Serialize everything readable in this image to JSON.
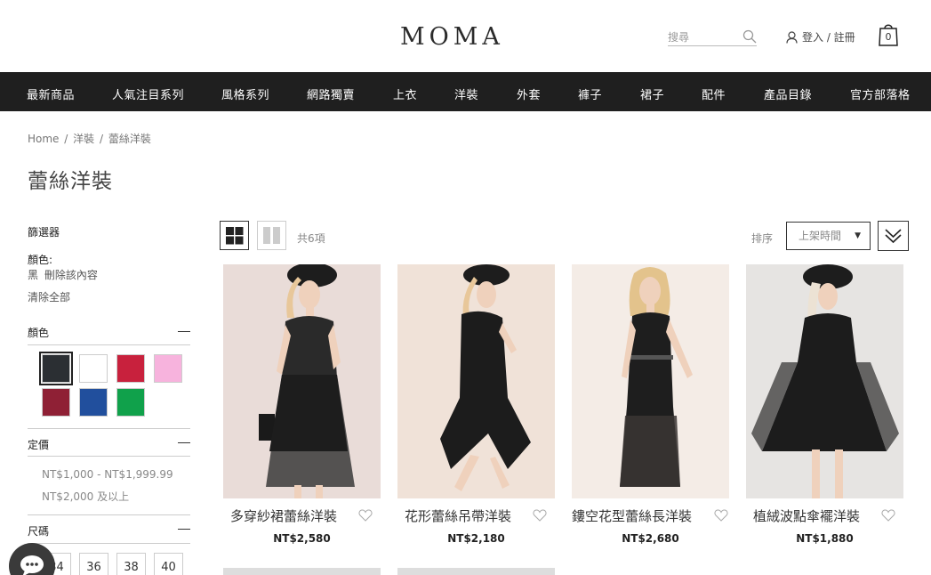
{
  "header": {
    "logo": "MOMA",
    "search_placeholder": "搜尋",
    "login_label": "登入 / 註冊",
    "cart_count": "0"
  },
  "nav": {
    "items": [
      "最新商品",
      "人氣注目系列",
      "風格系列",
      "網路獨賣",
      "上衣",
      "洋裝",
      "外套",
      "褲子",
      "裙子",
      "配件",
      "產品目錄",
      "官方部落格"
    ]
  },
  "breadcrumb": {
    "items": [
      "Home",
      "洋裝",
      "蕾絲洋裝"
    ],
    "separator": "/"
  },
  "page_title": "蕾絲洋裝",
  "sidebar": {
    "filter_title": "篩選器",
    "active_filter_label": "顏色:",
    "active_filter_value": "黑",
    "remove_label": "刪除該內容",
    "clear_all": "清除全部",
    "color_section": "顏色",
    "colors": [
      "#2b2f33",
      "#ffffff",
      "#c8213d",
      "#f7b3dd",
      "#8f2035",
      "#214f9d",
      "#10a14b"
    ],
    "price_section": "定價",
    "price_options": [
      "NT$1,000 - NT$1,999.99",
      "NT$2,000 及以上"
    ],
    "size_section": "尺碼",
    "sizes": [
      "34",
      "36",
      "38",
      "40"
    ]
  },
  "toolbar": {
    "count": "共6項",
    "sort_label": "排序",
    "sort_value": "上架時間"
  },
  "products": [
    {
      "name": "多穿紗裙蕾絲洋裝",
      "price": "NT$2,580"
    },
    {
      "name": "花形蕾絲吊帶洋裝",
      "price": "NT$2,180"
    },
    {
      "name": "鏤空花型蕾絲長洋裝",
      "price": "NT$2,680"
    },
    {
      "name": "植絨波點傘襬洋裝",
      "price": "NT$1,880"
    }
  ]
}
